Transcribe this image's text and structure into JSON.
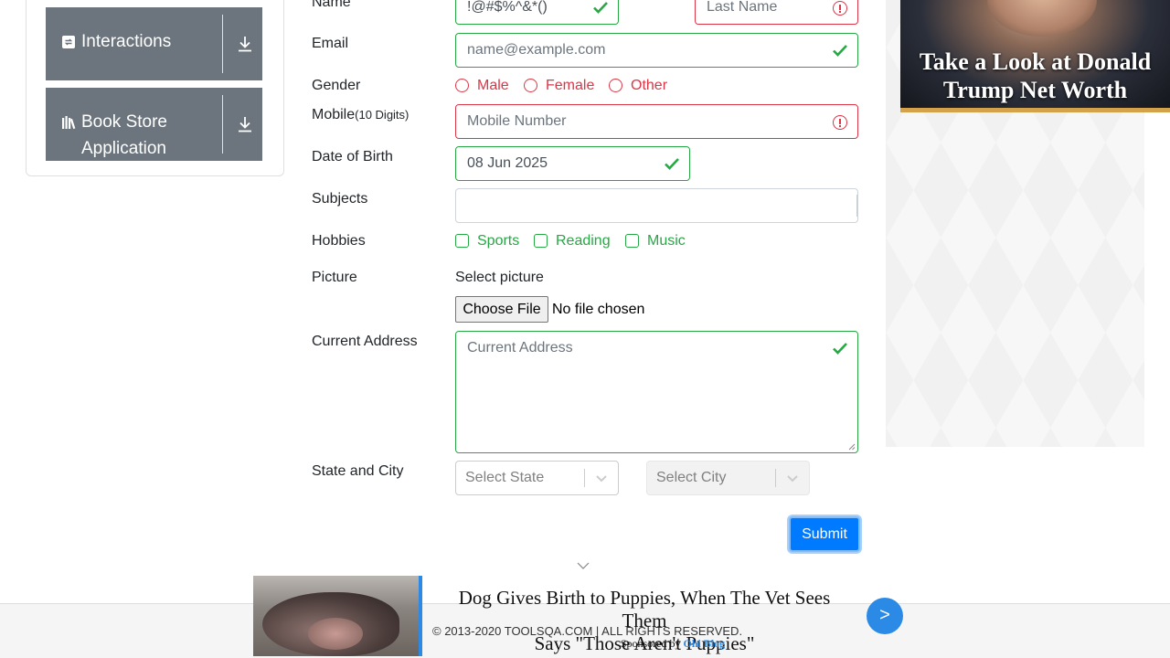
{
  "sidebar": {
    "items": [
      {
        "label": "Interactions",
        "icon": "interactions-icon"
      },
      {
        "label": "Book Store",
        "label2": "Application",
        "icon": "book-store-icon"
      }
    ]
  },
  "form": {
    "name_label": "Name",
    "first_name_value": "!@#$%^&*()",
    "last_name_placeholder": "Last Name",
    "email_label": "Email",
    "email_placeholder": "name@example.com",
    "gender_label": "Gender",
    "gender_options": [
      "Male",
      "Female",
      "Other"
    ],
    "mobile_label": "Mobile",
    "mobile_hint": "(10 Digits)",
    "mobile_placeholder": "Mobile Number",
    "dob_label": "Date of Birth",
    "dob_value": "08 Jun 2025",
    "subjects_label": "Subjects",
    "hobbies_label": "Hobbies",
    "hobbies_options": [
      "Sports",
      "Reading",
      "Music"
    ],
    "picture_label": "Picture",
    "select_picture": "Select picture",
    "choose_file": "Choose File",
    "no_file": "No file chosen",
    "address_label": "Current Address",
    "address_placeholder": "Current Address",
    "state_city_label": "State and City",
    "state_placeholder": "Select State",
    "city_placeholder": "Select City",
    "submit": "Submit"
  },
  "ad_right": {
    "headline_line1": "Take a Look at Donald",
    "headline_line2": "Trump Net Worth"
  },
  "ad_bottom": {
    "headline_line1": "Dog Gives Birth to Puppies, When The Vet Sees Them",
    "headline_line2": "Says \"Those Aren't Puppies\"",
    "sponsored_by": "Sponsored by",
    "sponsor": "Ohi Blog",
    "next": ">"
  },
  "footer": {
    "copyright": "© 2013-2020 TOOLSQA.COM | ALL RIGHTS RESERVED."
  },
  "colors": {
    "valid": "#28a745",
    "invalid": "#dc3545",
    "primary": "#007bff",
    "sidebar_item": "#6c757d"
  }
}
